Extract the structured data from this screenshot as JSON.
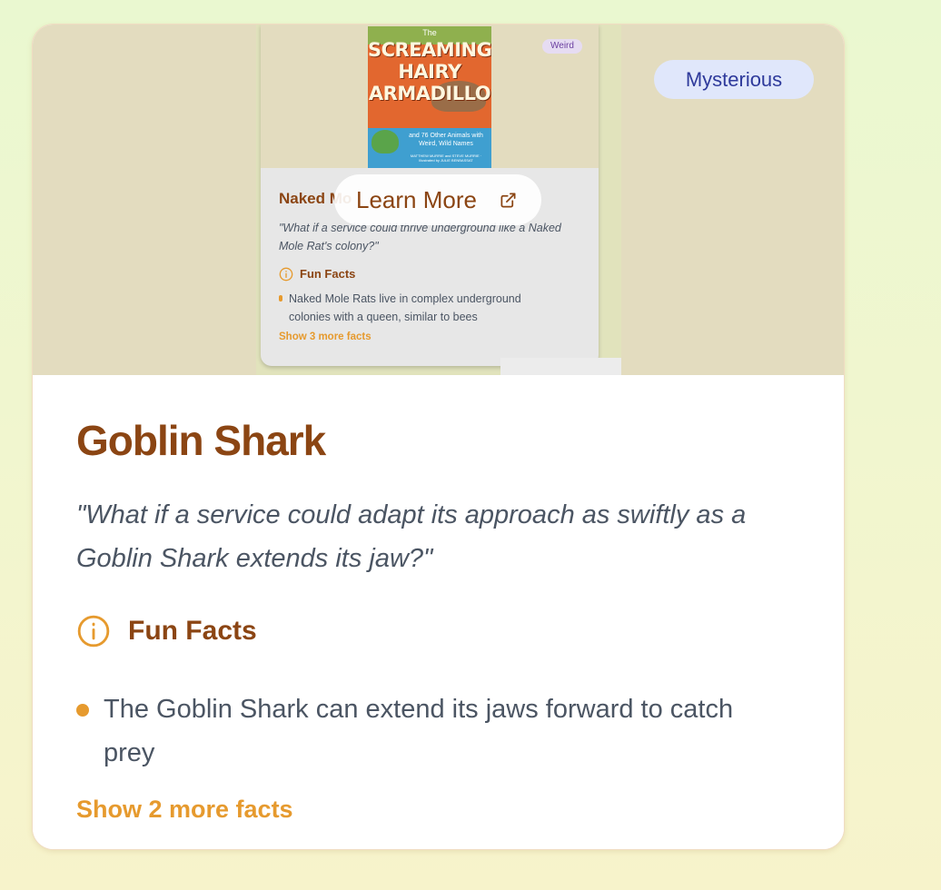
{
  "card": {
    "badge": "Mysterious",
    "learn_more": "Learn More",
    "title": "Goblin Shark",
    "quote": "\"What if a service could adapt its approach as swiftly as a Goblin Shark extends its jaw?\"",
    "fun_facts_label": "Fun Facts",
    "facts": [
      "The Goblin Shark can extend its jaws forward to catch prey"
    ],
    "show_more": "Show 2 more facts"
  },
  "preview_card": {
    "cover": {
      "top_text": "The",
      "title": "SCREAMING HAIRY ARMADILLO",
      "subtitle": "and 76 Other Animals with Weird, Wild Names",
      "authors": "MATTHEW MURRIE and STEVE MURRIE · Illustrated by JULIE BENBASSAT"
    },
    "badge": "Weird",
    "title": "Naked Mo",
    "quote": "\"What if a service could thrive underground like a Naked Mole Rat's colony?\"",
    "fun_facts_label": "Fun Facts",
    "fact": "Naked Mole Rats live in complex underground colonies with a queen, similar to bees",
    "show_more": "Show 3 more facts"
  },
  "colors": {
    "accent_brown": "#8b4513",
    "accent_orange": "#e69a2e",
    "badge_bg": "#e0e7fb",
    "badge_text": "#2e3a9b"
  },
  "icons": {
    "info": "info-circle-icon",
    "external_link": "external-link-icon"
  }
}
